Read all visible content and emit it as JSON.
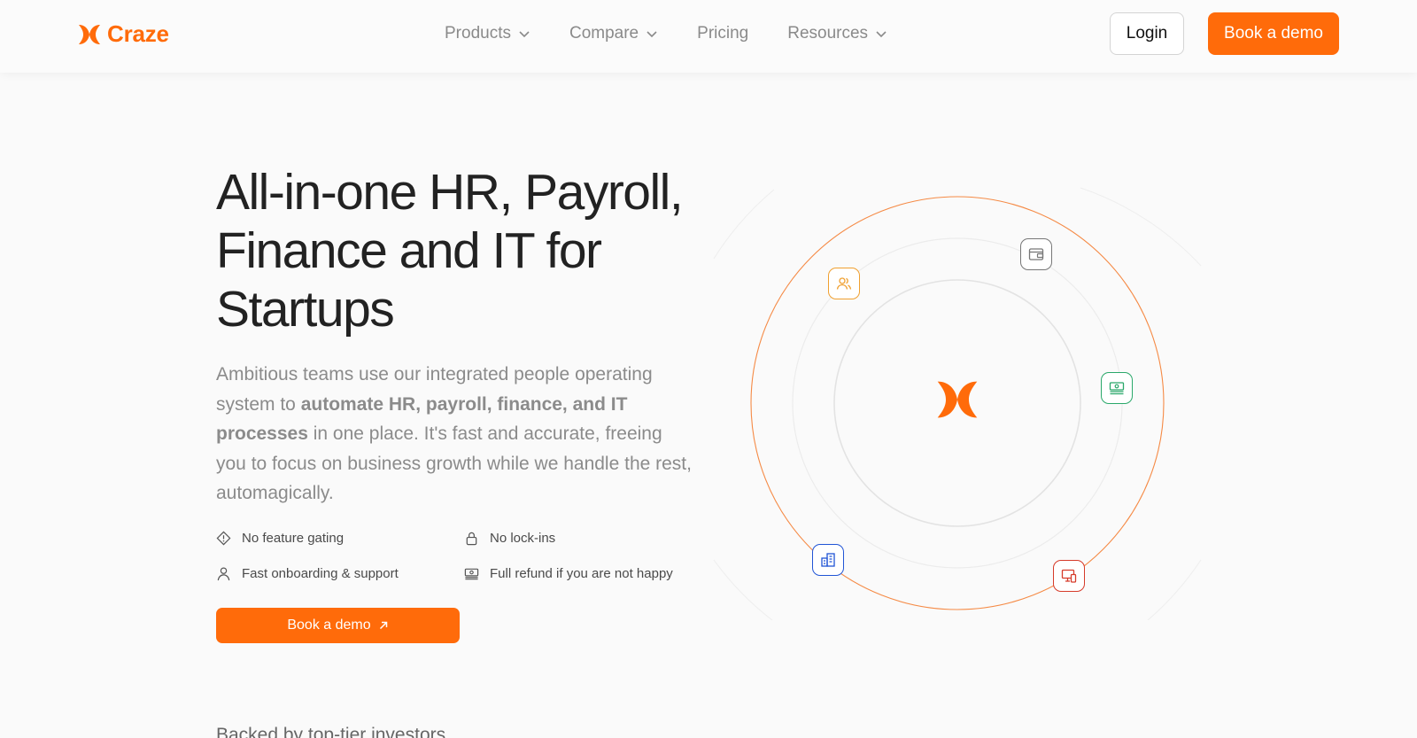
{
  "nav": {
    "brand": "Craze",
    "links": [
      {
        "label": "Products"
      },
      {
        "label": "Compare"
      },
      {
        "label": "Pricing"
      },
      {
        "label": "Resources"
      }
    ],
    "login_label": "Login",
    "demo_label": "Book a demo"
  },
  "hero": {
    "title": "All-in-one HR, Payroll, Finance and IT for Startups",
    "desc_part1": "Ambitious teams use our integrated people operating system to ",
    "desc_bold": "automate HR, payroll, finance, and IT processes",
    "desc_part2": " in one place. It's fast and accurate, freeing you to focus on business growth while we handle the rest, automagically.",
    "features": [
      {
        "label": "No feature gating",
        "icon": "tag-icon"
      },
      {
        "label": "No lock-ins",
        "icon": "lock-icon"
      },
      {
        "label": "Fast onboarding & support",
        "icon": "user-icon"
      },
      {
        "label": "Full refund if you are not happy",
        "icon": "cash-icon"
      }
    ],
    "cta_label": "Book a demo",
    "backed_text": "Backed by top-tier investors"
  },
  "colors": {
    "accent": "#ff6b0a",
    "people": "#f0a030",
    "wallet": "#777777",
    "money": "#2aa86a",
    "building": "#2155d6",
    "device": "#d63b2a"
  },
  "orbit_icons": [
    "people-icon",
    "wallet-icon",
    "money-icon",
    "building-icon",
    "device-icon"
  ]
}
